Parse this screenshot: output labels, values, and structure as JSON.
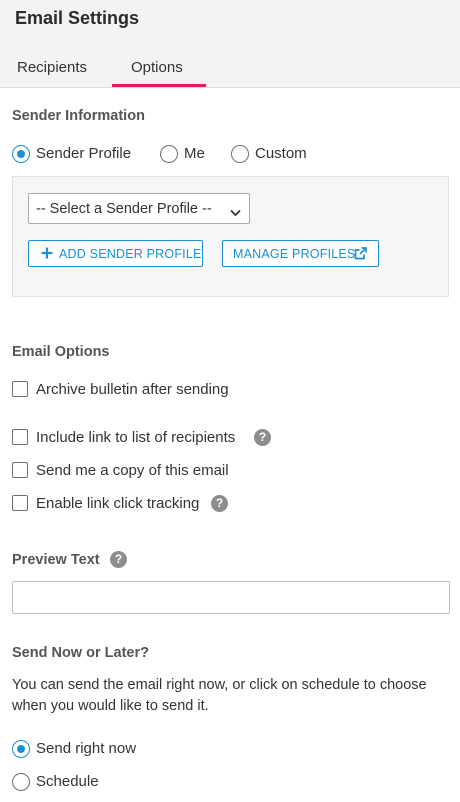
{
  "header": {
    "title": "Email Settings",
    "tabs": [
      {
        "label": "Recipients",
        "active": false
      },
      {
        "label": "Options",
        "active": true
      }
    ],
    "accent_color": "#e5195f"
  },
  "sender": {
    "section_title": "Sender Information",
    "options": [
      {
        "label": "Sender Profile",
        "checked": true
      },
      {
        "label": "Me",
        "checked": false
      },
      {
        "label": "Custom",
        "checked": false
      }
    ],
    "select_value": "-- Select a Sender Profile --",
    "add_button": "ADD SENDER PROFILE",
    "manage_button": "MANAGE PROFILES"
  },
  "email_options": {
    "section_title": "Email Options",
    "items": [
      {
        "label": "Archive bulletin after sending",
        "checked": false,
        "help": false
      },
      {
        "label": "Include link to list of recipients",
        "checked": false,
        "help": true
      },
      {
        "label": "Send me a copy of this email",
        "checked": false,
        "help": false
      },
      {
        "label": "Enable link click tracking",
        "checked": false,
        "help": true
      }
    ]
  },
  "preview": {
    "section_title": "Preview Text",
    "value": "",
    "placeholder": ""
  },
  "send": {
    "section_title": "Send Now or Later?",
    "description": "You can send the email right now, or click on schedule to choose when you would like to send it.",
    "options": [
      {
        "label": "Send right now",
        "checked": true
      },
      {
        "label": "Schedule",
        "checked": false
      }
    ]
  },
  "colors": {
    "primary": "#1a8fd2",
    "tab_underline": "#e5195f"
  },
  "icons": {
    "help": "?",
    "plus": "plus-icon",
    "external": "external-link-icon",
    "chevron": "chevron-down-icon"
  }
}
